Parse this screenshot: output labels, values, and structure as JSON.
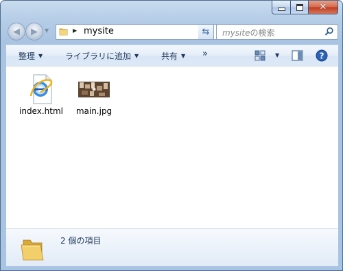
{
  "window": {
    "title_buttons": {
      "minimize_icon": "minimize-icon",
      "maximize_icon": "maximize-icon",
      "close_icon": "close-icon"
    }
  },
  "navigation": {
    "address_path": "mysite",
    "search_placeholder_name": "mysite",
    "search_placeholder_suffix": "の検索"
  },
  "toolbar": {
    "organize_label": "整理",
    "add_to_library_label": "ライブラリに追加",
    "share_label": "共有",
    "more_label": "»"
  },
  "files": [
    {
      "name": "index.html",
      "icon": "ie-html-icon"
    },
    {
      "name": "main.jpg",
      "icon": "jpg-thumbnail"
    }
  ],
  "details_pane": {
    "item_count_text": "2 個の項目"
  },
  "colors": {
    "frame": "#a9c4e2",
    "toolbar_text": "#1e395b",
    "content_bg": "#ffffff"
  }
}
